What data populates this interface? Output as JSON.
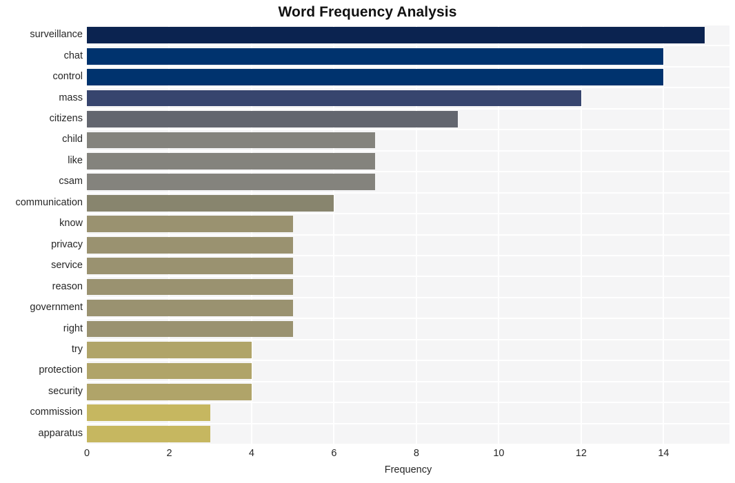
{
  "chart_data": {
    "type": "bar",
    "orientation": "horizontal",
    "title": "Word Frequency Analysis",
    "xlabel": "Frequency",
    "ylabel": "",
    "categories": [
      "surveillance",
      "chat",
      "control",
      "mass",
      "citizens",
      "child",
      "like",
      "csam",
      "communication",
      "know",
      "privacy",
      "service",
      "reason",
      "government",
      "right",
      "try",
      "protection",
      "security",
      "commission",
      "apparatus"
    ],
    "values": [
      15,
      14,
      14,
      12,
      9,
      7,
      7,
      7,
      6,
      5,
      5,
      5,
      5,
      5,
      5,
      4,
      4,
      4,
      3,
      3
    ],
    "bar_colors": [
      "#0b2350",
      "#00336e",
      "#00336e",
      "#37456e",
      "#63666f",
      "#84837d",
      "#84837d",
      "#84837d",
      "#88856e",
      "#9a9270",
      "#9a9270",
      "#9a9270",
      "#9a9270",
      "#9a9270",
      "#9a9270",
      "#b0a469",
      "#b0a469",
      "#b0a469",
      "#c6b760",
      "#c6b760"
    ],
    "xticks": [
      0,
      2,
      4,
      6,
      8,
      10,
      12,
      14
    ],
    "xlim": [
      0,
      15.6
    ],
    "grid": true,
    "grid_color": "#ffffff",
    "plot_background": "#f5f5f6",
    "figure_background": "#ffffff",
    "title_color": "#111111",
    "tick_label_color": "#262626"
  }
}
